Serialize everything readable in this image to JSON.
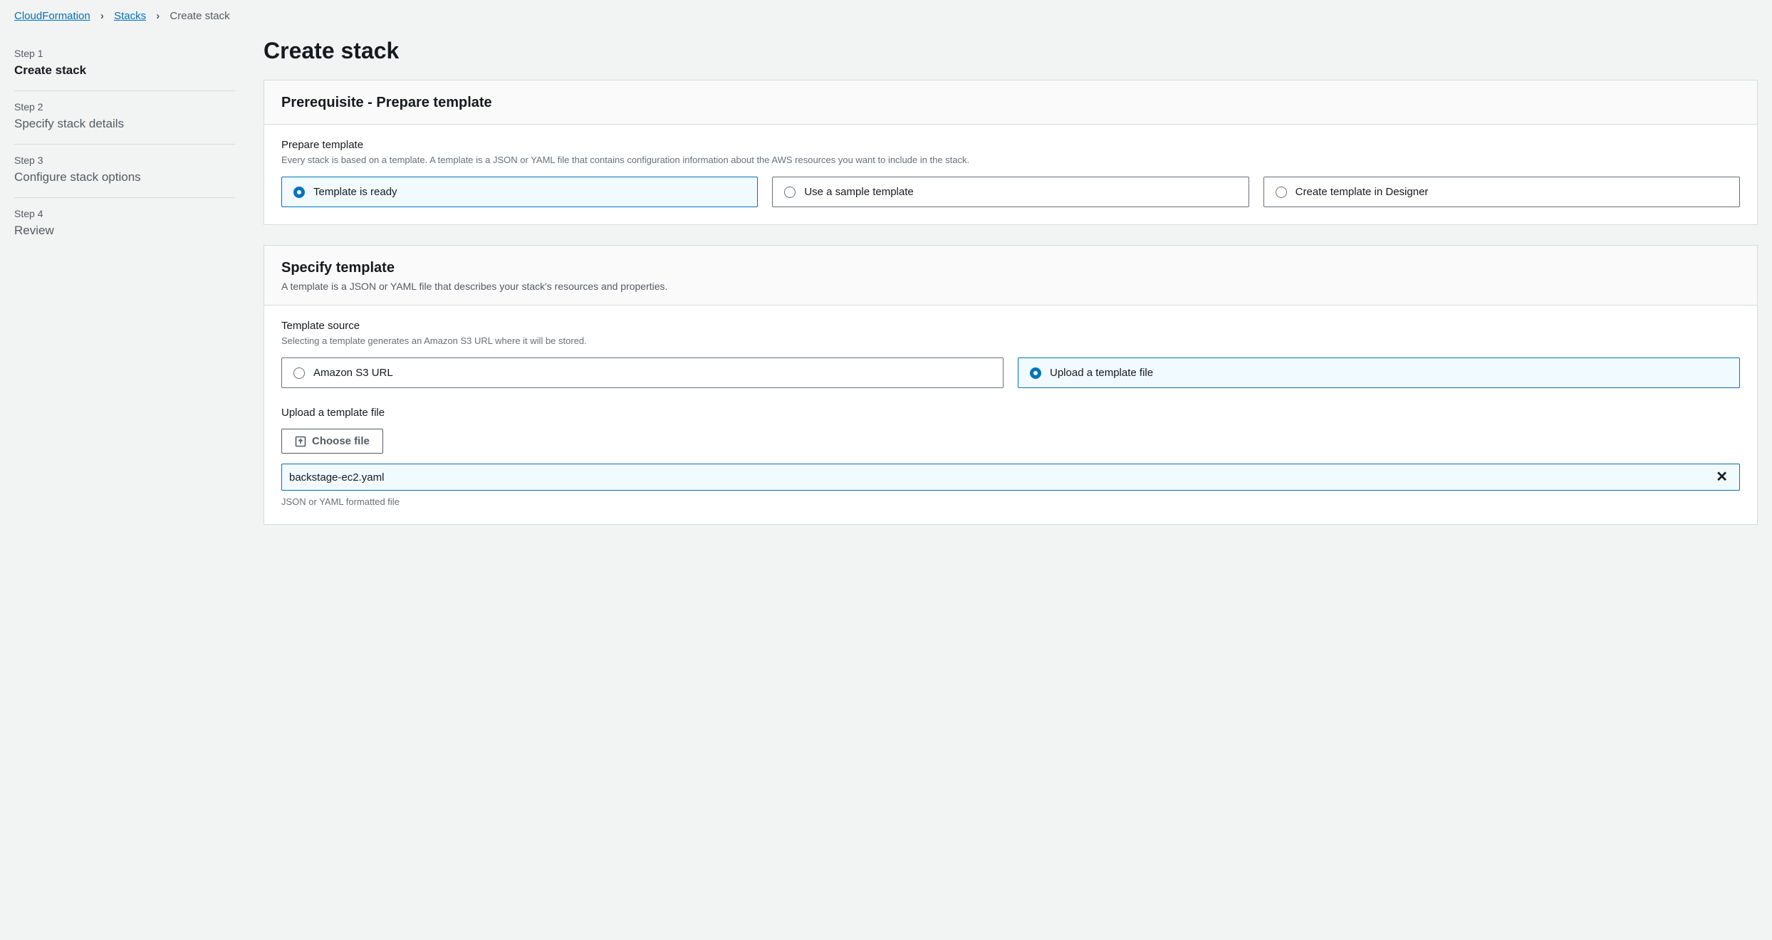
{
  "breadcrumbs": {
    "item1": "CloudFormation",
    "item2": "Stacks",
    "current": "Create stack"
  },
  "sidebar": {
    "steps": [
      {
        "num": "Step 1",
        "title": "Create stack"
      },
      {
        "num": "Step 2",
        "title": "Specify stack details"
      },
      {
        "num": "Step 3",
        "title": "Configure stack options"
      },
      {
        "num": "Step 4",
        "title": "Review"
      }
    ]
  },
  "page_title": "Create stack",
  "panel1": {
    "title": "Prerequisite - Prepare template",
    "field_label": "Prepare template",
    "field_hint": "Every stack is based on a template. A template is a JSON or YAML file that contains configuration information about the AWS resources you want to include in the stack.",
    "options": {
      "opt1": "Template is ready",
      "opt2": "Use a sample template",
      "opt3": "Create template in Designer"
    }
  },
  "panel2": {
    "title": "Specify template",
    "subtitle": "A template is a JSON or YAML file that describes your stack's resources and properties.",
    "source_label": "Template source",
    "source_hint": "Selecting a template generates an Amazon S3 URL where it will be stored.",
    "source_options": {
      "opt1": "Amazon S3 URL",
      "opt2": "Upload a template file"
    },
    "upload_label": "Upload a template file",
    "choose_file": "Choose file",
    "file_name": "backstage-ec2.yaml",
    "file_hint": "JSON or YAML formatted file"
  }
}
